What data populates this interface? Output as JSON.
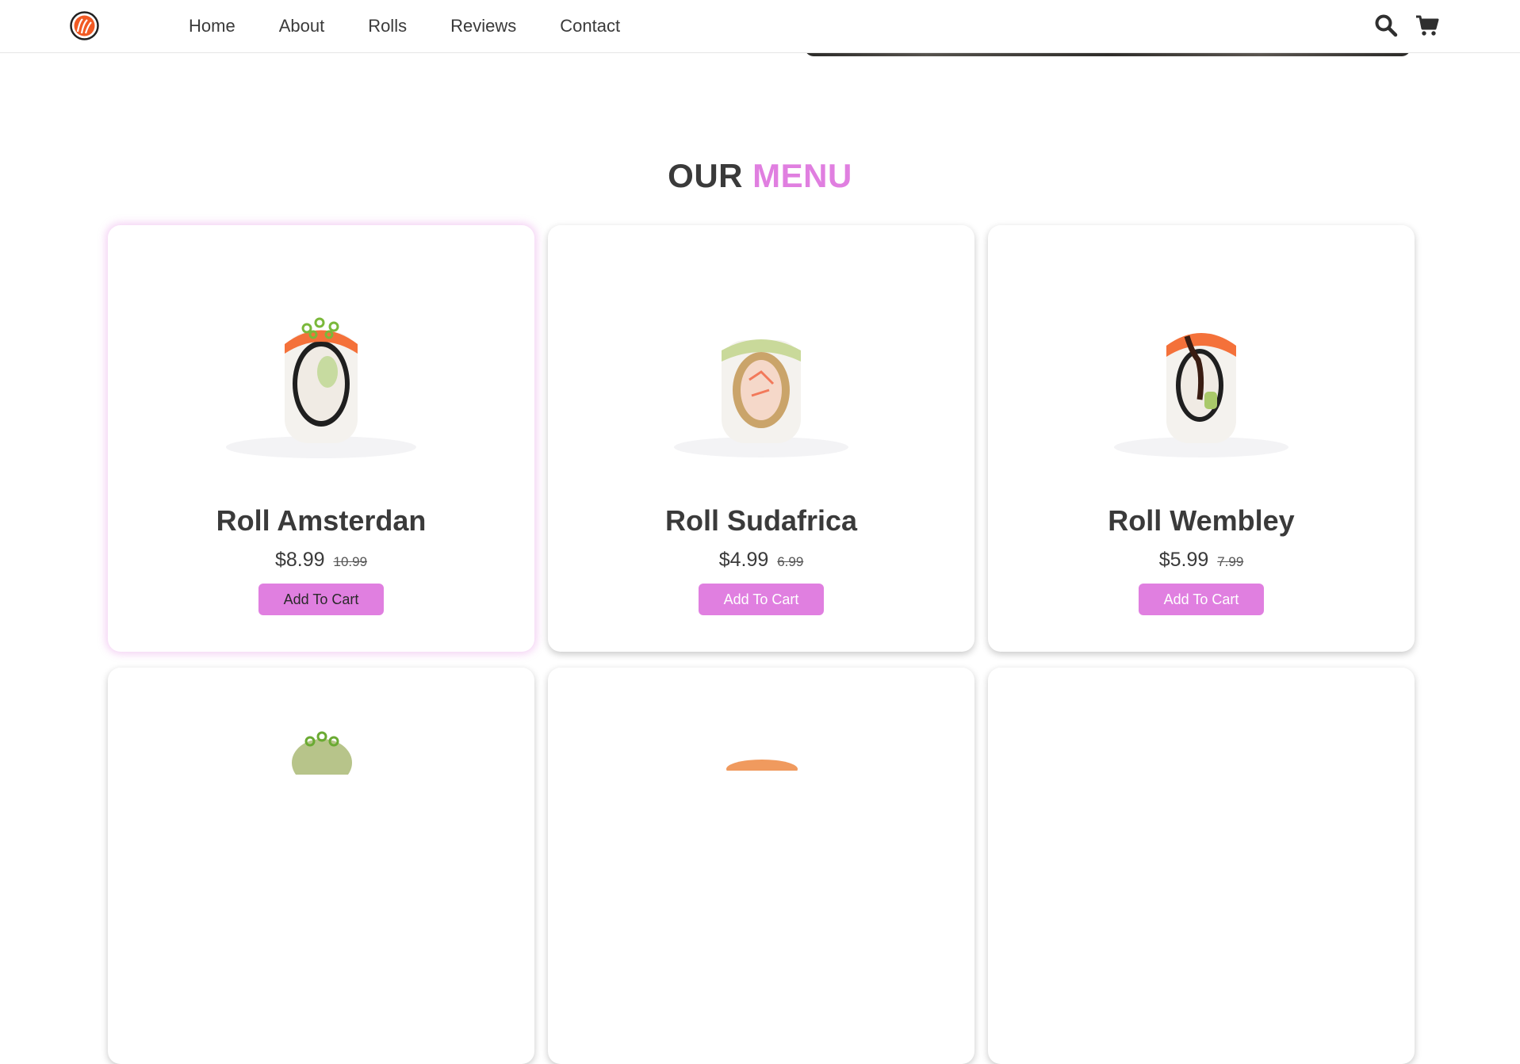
{
  "nav": {
    "links": [
      "Home",
      "About",
      "Rolls",
      "Reviews",
      "Contact"
    ],
    "icons": [
      "search-icon",
      "cart-icon"
    ]
  },
  "menu": {
    "heading_part1": "OUR",
    "heading_part2": "MENU",
    "items": [
      {
        "name": "Roll Amsterdan",
        "price": "$8.99",
        "old_price": "10.99",
        "button": "Add To Cart"
      },
      {
        "name": "Roll Sudafrica",
        "price": "$4.99",
        "old_price": "6.99",
        "button": "Add To Cart"
      },
      {
        "name": "Roll Wembley",
        "price": "$5.99",
        "old_price": "7.99",
        "button": "Add To Cart"
      }
    ]
  },
  "colors": {
    "accent": "#e07fe0",
    "text": "#3a3a3a",
    "salmon": "#f4713a"
  }
}
